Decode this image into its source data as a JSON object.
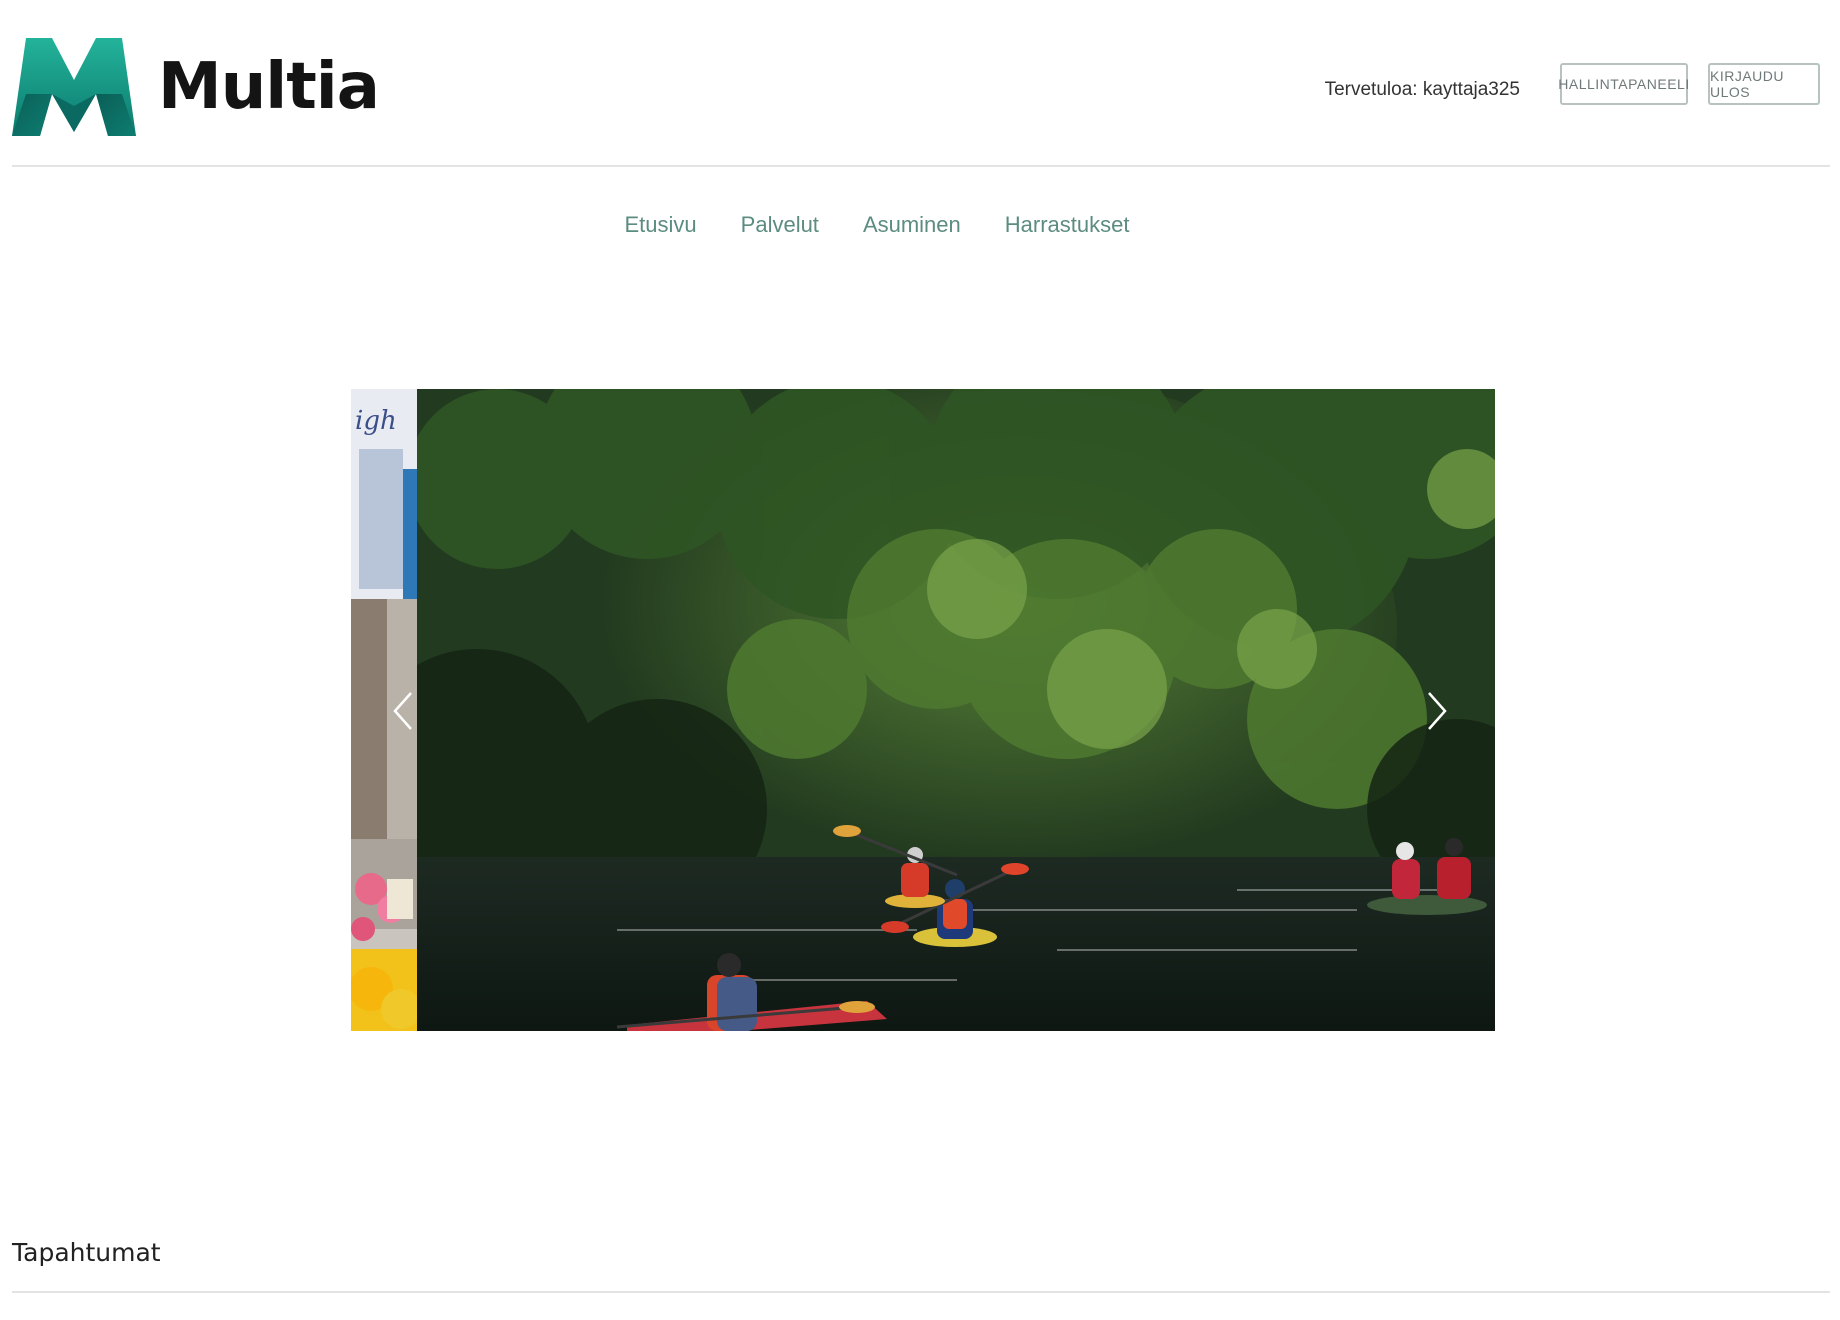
{
  "brand": {
    "name": "Multia",
    "colors": {
      "primary": "#1a9a88",
      "dark": "#0e6e66"
    }
  },
  "header": {
    "welcome": "Tervetuloa: kayttaja325",
    "dashboard_label": "HALLINTAPANEELI",
    "logout_label": "KIRJAUDU ULOS"
  },
  "nav": {
    "items": [
      {
        "label": "Etusivu"
      },
      {
        "label": "Palvelut"
      },
      {
        "label": "Asuminen"
      },
      {
        "label": "Harrastukset"
      }
    ]
  },
  "carousel": {
    "prev_icon": "chevron-left-icon",
    "next_icon": "chevron-right-icon"
  },
  "events": {
    "title": "Tapahtumat"
  }
}
